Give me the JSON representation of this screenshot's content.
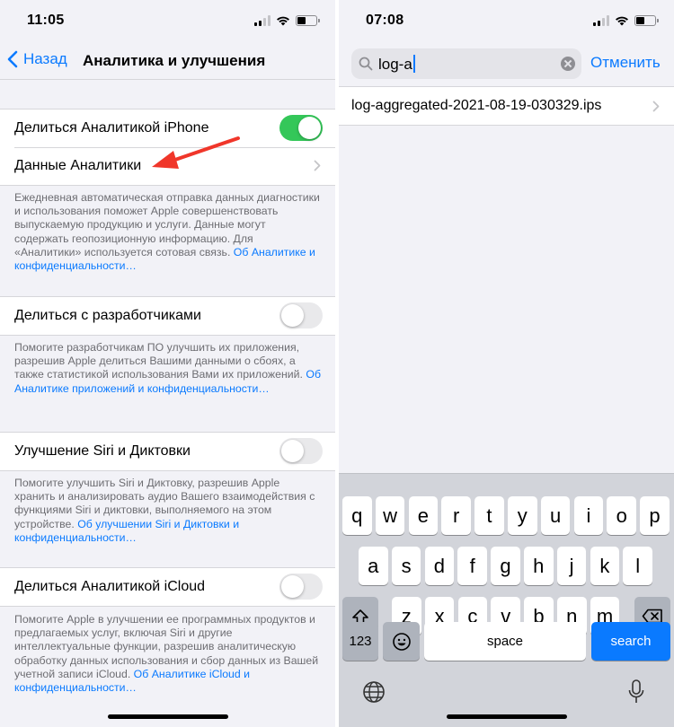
{
  "left": {
    "time": "11:05",
    "nav": {
      "back_label": "Назад",
      "title": "Аналитика и улучшения"
    },
    "group1": {
      "share_iphone_label": "Делиться Аналитикой iPhone",
      "share_iphone_on": true,
      "data_label": "Данные Аналитики"
    },
    "note1": {
      "text": "Ежедневная автоматическая отправка данных диагностики и использования поможет Apple совершенствовать выпускаемую продукцию и услуги. Данные могут содержать геопозиционную информацию. Для «Аналитики» используется сотовая связь.",
      "link": "Об Аналитике и конфиденциальности…"
    },
    "dev": {
      "label": "Делиться с разработчиками",
      "on": false
    },
    "note2": {
      "text": "Помогите разработчикам ПО улучшить их приложения, разрешив Apple делиться Вашими данными о сбоях, а также статистикой использования Вами их приложений.",
      "link": "Об Аналитике приложений и конфиденциальности…"
    },
    "siri": {
      "label": "Улучшение Siri и Диктовки",
      "on": false
    },
    "note3": {
      "text": "Помогите улучшить Siri и Диктовку, разрешив Apple хранить и анализировать аудио Вашего взаимодействия с функциями Siri и диктовки, выполняемого на этом устройстве.",
      "link": "Об улучшении Siri и Диктовки и конфиденциальности…"
    },
    "icloud": {
      "label": "Делиться Аналитикой iCloud",
      "on": false
    },
    "note4": {
      "text": "Помогите Apple в улучшении ее программных продуктов и предлагаемых услуг, включая Siri и другие интеллектуальные функции, разрешив аналитическую обработку данных использования и сбор данных из Вашей учетной записи iCloud.",
      "link": "Об Аналитике iCloud и конфиденциальности…"
    }
  },
  "right": {
    "time": "07:08",
    "search": {
      "value": "log-a",
      "cancel_label": "Отменить"
    },
    "result": "log-aggregated-2021-08-19-030329.ips",
    "keyboard": {
      "row1": [
        "q",
        "w",
        "e",
        "r",
        "t",
        "y",
        "u",
        "i",
        "o",
        "p"
      ],
      "row2": [
        "a",
        "s",
        "d",
        "f",
        "g",
        "h",
        "j",
        "k",
        "l"
      ],
      "row3": [
        "z",
        "x",
        "c",
        "v",
        "b",
        "n",
        "m"
      ],
      "numbers_label": "123",
      "space_label": "space",
      "search_label": "search"
    }
  },
  "colors": {
    "accent": "#0a7aff",
    "toggle_on": "#34c759",
    "arrow": "#f0362a"
  }
}
